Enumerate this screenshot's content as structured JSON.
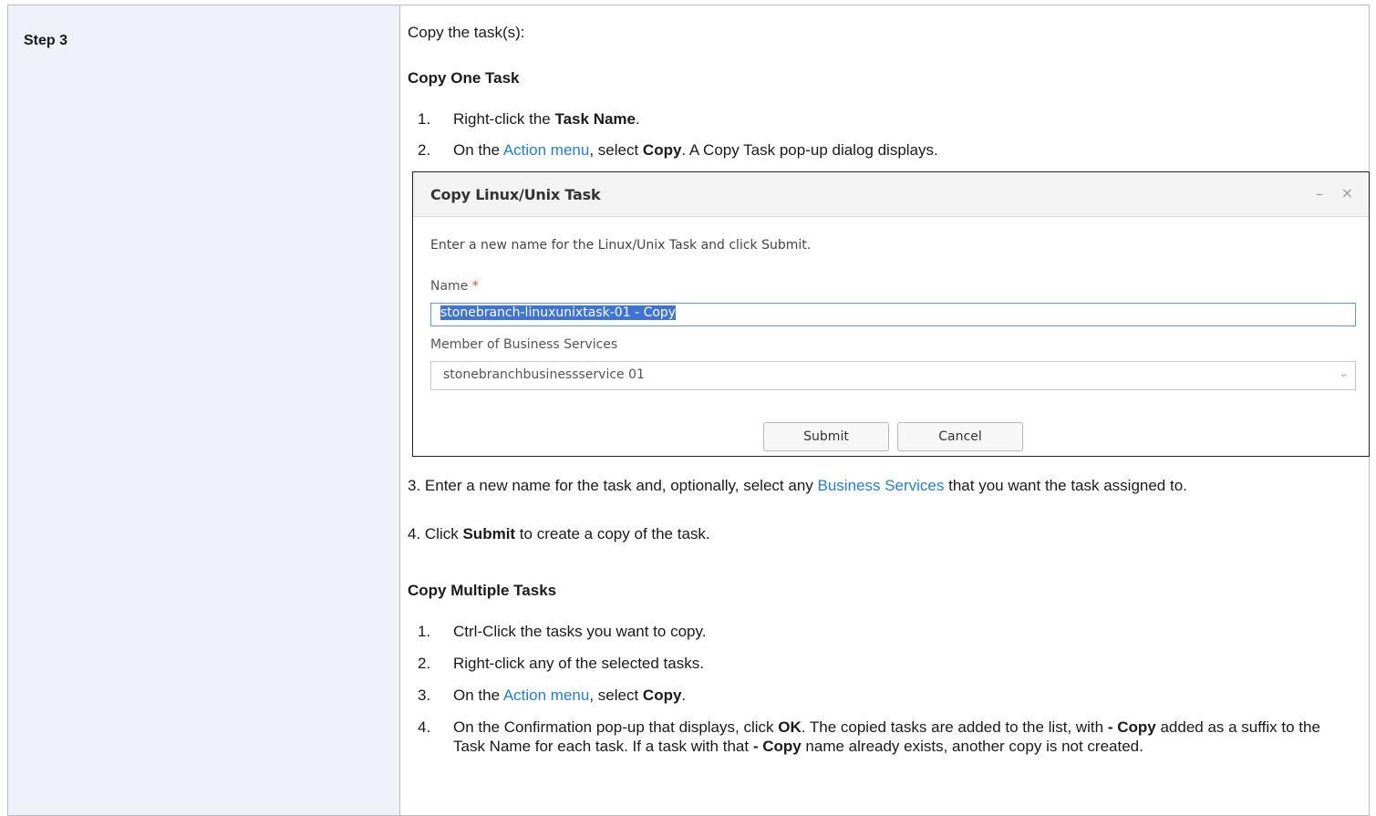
{
  "step": {
    "label": "Step 3"
  },
  "intro": "Copy the task(s):",
  "copy_one": {
    "heading": "Copy One Task",
    "items": [
      {
        "num": "1.",
        "pre": "Right-click the ",
        "bold": "Task Name",
        "post": "."
      },
      {
        "num": "2.",
        "pre": "On the ",
        "link": "Action menu",
        "mid": ", select ",
        "bold": "Copy",
        "post": ". A Copy Task pop-up dialog displays."
      }
    ]
  },
  "dialog": {
    "title": "Copy Linux/Unix Task",
    "minimize_icon": "–",
    "close_icon": "×",
    "message": "Enter a new name for the Linux/Unix Task and click Submit.",
    "name_label": "Name",
    "required_mark": "*",
    "name_value": "stonebranch-linuxunixtask-01 - Copy",
    "bs_label": "Member of Business Services",
    "bs_value": "stonebranchbusinessservice 01",
    "submit_label": "Submit",
    "cancel_label": "Cancel"
  },
  "after_dialog": {
    "step3_pre": "3. Enter a new name for the task and, optionally, select any ",
    "step3_link": "Business Services",
    "step3_post": " that you want the task assigned to.",
    "step4_pre": "4. Click ",
    "step4_bold": "Submit",
    "step4_post": " to create a copy of the task."
  },
  "copy_multiple": {
    "heading": "Copy Multiple Tasks",
    "items": [
      {
        "num": "1.",
        "text": "Ctrl-Click the tasks you want to copy."
      },
      {
        "num": "2.",
        "text": "Right-click any of the selected tasks."
      },
      {
        "num": "3.",
        "pre": "On the ",
        "link": "Action menu",
        "mid": ", select ",
        "bold": "Copy",
        "post": "."
      },
      {
        "num": "4.",
        "pre": "On the Confirmation pop-up that displays, click ",
        "bold": "OK",
        "mid": ". The copied tasks are added to the list, with ",
        "bold2": "- Copy",
        "mid2": " added as a suffix to the Task Name for each task. If a task with that ",
        "bold3": "- Copy",
        "post": " name already exists, another copy is not created."
      }
    ]
  },
  "colors": {
    "link": "#1f7fd6",
    "left_cell_bg": "#eef1f7",
    "selection": "#3e74d4"
  }
}
